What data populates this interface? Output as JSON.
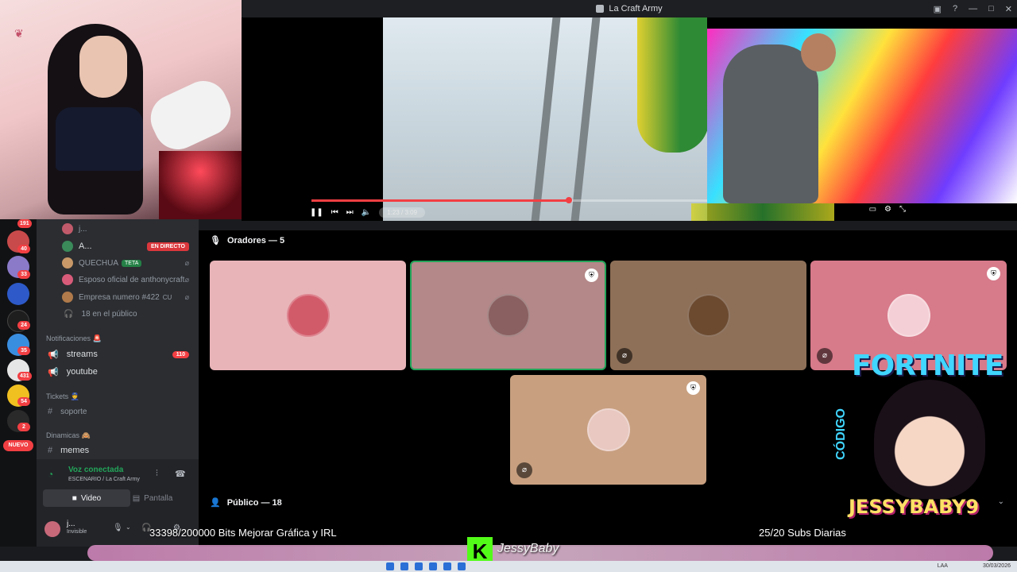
{
  "window": {
    "title": "La Craft Army"
  },
  "player": {
    "time": "1:23 / 3:09",
    "progress": 0.65
  },
  "rail": {
    "badges": [
      "191",
      "40",
      "33",
      "24",
      "35",
      "431",
      "54",
      "2"
    ],
    "nuevo": "NUEVO"
  },
  "members": [
    {
      "name": "j...",
      "color": "#c15a6a"
    },
    {
      "name": "A...",
      "live": "EN DIRECTO",
      "color": "#3a8a5a"
    },
    {
      "name": "QUECHUA",
      "tag": "TETA",
      "color": "#c89868"
    },
    {
      "name": "Esposo oficial de anthonycraft",
      "color": "#d85b7a"
    },
    {
      "name": "Empresa numero #422",
      "tag2": "CU",
      "color": "#b07a4a"
    }
  ],
  "public_count": "18 en el público",
  "categories": {
    "notifications": "Notificaciones 🚨",
    "tickets": "Tickets 👮",
    "dynamics": "Dinamicas 🙈"
  },
  "channels": {
    "streams": {
      "label": "streams",
      "count": "110"
    },
    "youtube": {
      "label": "youtube"
    },
    "soporte": {
      "label": "soporte"
    },
    "memes": {
      "label": "memes"
    }
  },
  "voice": {
    "status": "Voz conectada",
    "location": "ESCENARIO / La Craft Army",
    "video": "Video",
    "screen": "Pantalla"
  },
  "user": {
    "name": "j...",
    "status": "Invisible"
  },
  "stage": {
    "speakers": "Oradores — 5",
    "audience": "Público — 18"
  },
  "speaker_tiles": [
    {
      "bg": "#e8b4b8",
      "avatar": "#d25b6a",
      "mod": false,
      "muted": false
    },
    {
      "bg": "#b48888",
      "avatar": "#8a6060",
      "mod": true,
      "muted": false,
      "active": true
    },
    {
      "bg": "#8e7058",
      "avatar": "#6b4a30",
      "mod": false,
      "muted": true
    },
    {
      "bg": "#d77a8a",
      "avatar": "#f4d0d6",
      "mod": true,
      "muted": true
    },
    {
      "bg": "#c8a080",
      "avatar": "#e8c8c0",
      "mod": true,
      "muted": true
    }
  ],
  "overlay": {
    "game": "FORTNITE",
    "code_label": "CÓDIGO",
    "gamertag": "JESSYBABY9",
    "goal_left": "33398/200000 Bits Mejorar Gráfica y IRL",
    "goal_right": "25/20 Subs Diarias",
    "kick_letter": "K",
    "handle": "JessyBaby"
  },
  "taskbar": {
    "lang": "LAA",
    "date": "30/03/2026"
  }
}
